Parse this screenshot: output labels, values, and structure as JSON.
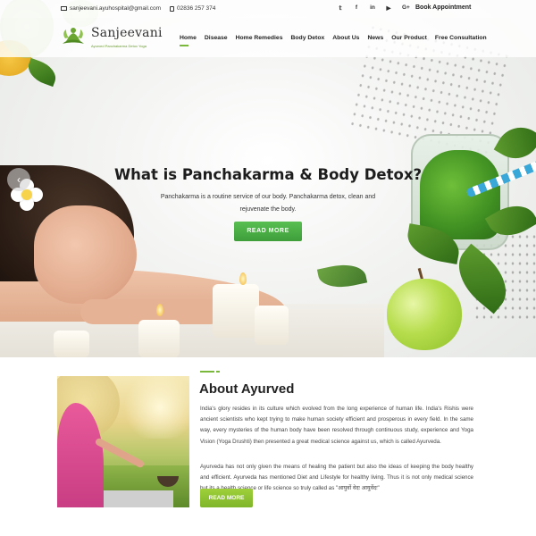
{
  "topbar": {
    "email": "sanjeevani.ayuhospital@gmail.com",
    "phone": "02836 257 374",
    "social_icons": [
      "twitter-icon",
      "facebook-icon",
      "linkedin-icon",
      "youtube-icon",
      "google-plus-icon"
    ],
    "social_glyphs": [
      "𝕥",
      "f",
      "in",
      "▶",
      "G+"
    ],
    "book_label": "Book Appointment"
  },
  "header": {
    "logo_name": "Sanjeevani",
    "logo_tag": "Ayurved   Panchakarma Detox   Yoga",
    "nav": [
      {
        "label": "Home",
        "active": true
      },
      {
        "label": "Disease"
      },
      {
        "label": "Home Remedies"
      },
      {
        "label": "Body Detox"
      },
      {
        "label": "About Us"
      },
      {
        "label": "News"
      },
      {
        "label": "Our Product"
      },
      {
        "label": "Free Consultation"
      }
    ]
  },
  "hero": {
    "title": "What is Panchakarma & Body Detox?",
    "subtitle": "Panchakarma is a routine service of our body. Panchakarma detox, clean and rejuvenate the body.",
    "button": "READ MORE",
    "prev_arrow": "‹"
  },
  "about": {
    "title": "About Ayurved",
    "paragraph1": "India's glory resides in its culture which evolved from the long experience of human life. India's Rishis were ancient scientists who kept trying to make human society efficient and prosperous in every field. In the same way, every mysteries of the human body have been resolved through continuous study, experience and Yoga Vision (Yoga Drushti) then presented a great medical science against us, which is called Ayurveda.",
    "paragraph2": "Ayurveda has not only given the means of healing the patient but also the ideas of keeping the body healthy and efficient. Ayurveda has mentioned Diet and Lifestyle for healthy living. Thus it is not only medical science but its a health science or life science so truly called as \"आयुर्वो वेदः आयुर्वेदः\"",
    "button": "READ MORE"
  },
  "colors": {
    "accent_green": "#7ab83c",
    "hero_button": "#4caf48",
    "about_button": "#8fc232"
  }
}
